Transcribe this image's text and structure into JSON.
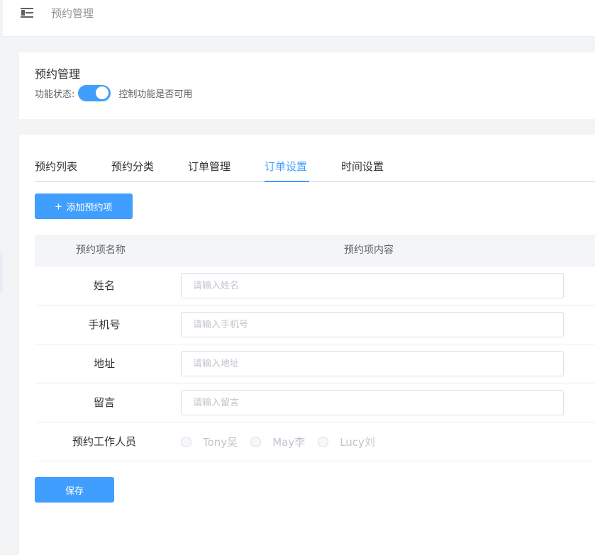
{
  "header": {
    "title": "预约管理",
    "menu_icon": "menu-fold-icon"
  },
  "feature_card": {
    "title": "预约管理",
    "status_label": "功能状态:",
    "switch_on": true,
    "switch_desc": "控制功能是否可用"
  },
  "tabs": [
    {
      "label": "预约列表",
      "active": false
    },
    {
      "label": "预约分类",
      "active": false
    },
    {
      "label": "订单管理",
      "active": false
    },
    {
      "label": "订单设置",
      "active": true
    },
    {
      "label": "时间设置",
      "active": false
    }
  ],
  "add_button": {
    "label": "添加预约项",
    "icon": "plus-icon"
  },
  "table": {
    "columns": [
      "预约项名称",
      "预约项内容"
    ],
    "rows": [
      {
        "label": "姓名",
        "placeholder": "请输入姓名"
      },
      {
        "label": "手机号",
        "placeholder": "请输入手机号"
      },
      {
        "label": "地址",
        "placeholder": "请输入地址"
      },
      {
        "label": "留言",
        "placeholder": "请输入留言"
      }
    ],
    "staff_row": {
      "label": "预约工作人员",
      "options": [
        "Tony吴",
        "May李",
        "Lucy刘"
      ]
    }
  },
  "save_button": {
    "label": "保存"
  },
  "colors": {
    "primary": "#409eff",
    "background": "#f3f4f6"
  }
}
